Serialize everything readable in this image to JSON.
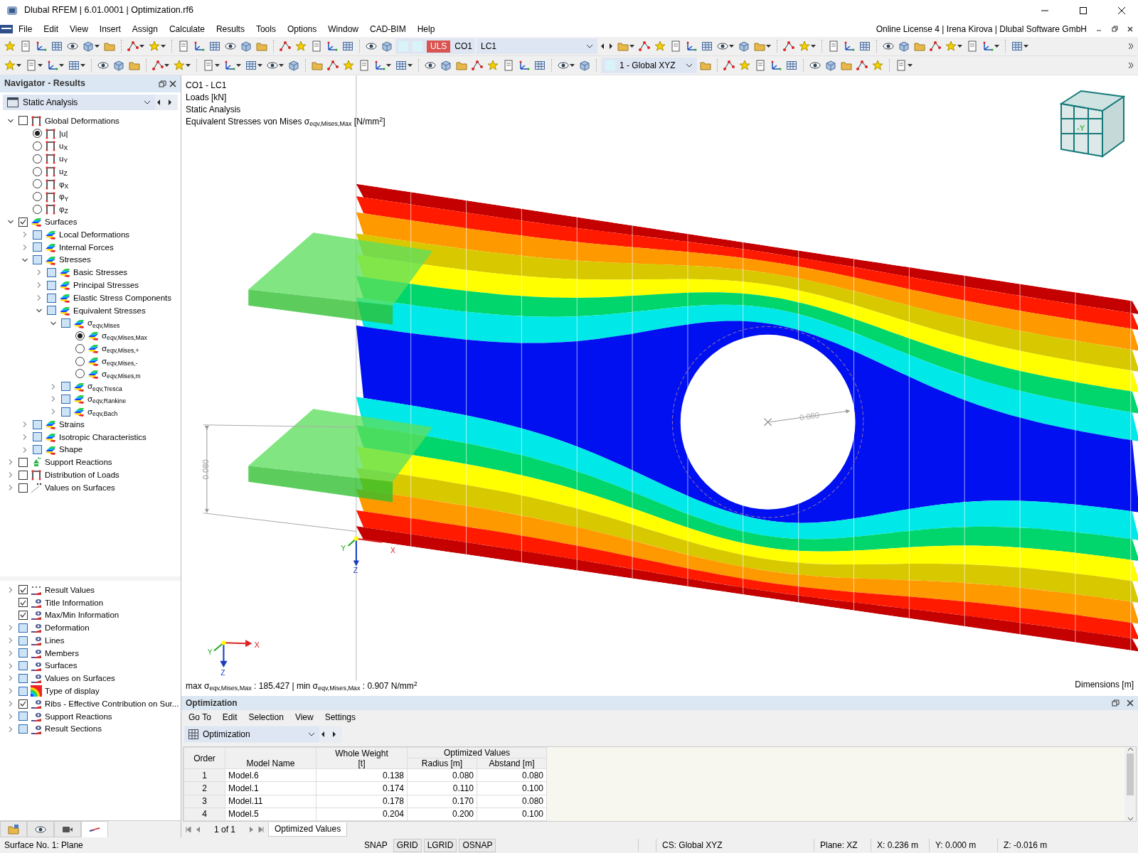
{
  "window": {
    "title": "Dlubal RFEM | 6.01.0001 | Optimization.rf6"
  },
  "menu": [
    "File",
    "Edit",
    "View",
    "Insert",
    "Assign",
    "Calculate",
    "Results",
    "Tools",
    "Options",
    "Window",
    "CAD-BIM",
    "Help"
  ],
  "license": "Online License 4 | Irena Kirova | Dlubal Software GmbH",
  "toolbar": {
    "design_situation": "ULS",
    "combination": "CO1",
    "load_case": "LC1",
    "coordinate_system": "1 - Global XYZ"
  },
  "navigator": {
    "title": "Navigator - Results",
    "analysis": "Static Analysis",
    "tree": [
      {
        "label": "Global Deformations",
        "kind": "deformation",
        "checked": false,
        "expanded": true,
        "children": [
          {
            "label": "|u|",
            "kind": "deformation",
            "selected": true
          },
          {
            "label": "u$_{X}$",
            "kind": "deformation",
            "selected": false
          },
          {
            "label": "u$_{Y}$",
            "kind": "deformation",
            "selected": false
          },
          {
            "label": "u$_{Z}$",
            "kind": "deformation",
            "selected": false
          },
          {
            "label": "φ$_{X}$",
            "kind": "deformation",
            "selected": false
          },
          {
            "label": "φ$_{Y}$",
            "kind": "deformation",
            "selected": false
          },
          {
            "label": "φ$_{Z}$",
            "kind": "deformation",
            "selected": false
          }
        ]
      },
      {
        "label": "Surfaces",
        "kind": "surface",
        "checked": true,
        "expanded": true,
        "children": [
          {
            "label": "Local Deformations",
            "kind": "surface",
            "checked": false,
            "expanded": false
          },
          {
            "label": "Internal Forces",
            "kind": "surface",
            "checked": false,
            "expanded": false
          },
          {
            "label": "Stresses",
            "kind": "surface",
            "checked": false,
            "expanded": true,
            "children": [
              {
                "label": "Basic Stresses",
                "kind": "surface",
                "checked": false,
                "expanded": false
              },
              {
                "label": "Principal Stresses",
                "kind": "surface",
                "checked": false,
                "expanded": false
              },
              {
                "label": "Elastic Stress Components",
                "kind": "surface",
                "checked": false,
                "expanded": false
              },
              {
                "label": "Equivalent Stresses",
                "kind": "surface",
                "checked": false,
                "expanded": true,
                "children": [
                  {
                    "label": "σ$_{eqv,Mises}$",
                    "kind": "surface",
                    "checked": false,
                    "expanded": true,
                    "children": [
                      {
                        "label": "σ$_{eqv,Mises,Max}$",
                        "kind": "surface",
                        "selected": true
                      },
                      {
                        "label": "σ$_{eqv,Mises,+}$",
                        "kind": "surface",
                        "selected": false
                      },
                      {
                        "label": "σ$_{eqv,Mises,-}$",
                        "kind": "surface",
                        "selected": false
                      },
                      {
                        "label": "σ$_{eqv,Mises,m}$",
                        "kind": "surface",
                        "selected": false
                      }
                    ]
                  },
                  {
                    "label": "σ$_{eqv,Tresca}$",
                    "kind": "surface",
                    "checked": false,
                    "expanded": false
                  },
                  {
                    "label": "σ$_{eqv,Rankine}$",
                    "kind": "surface",
                    "checked": false,
                    "expanded": false
                  },
                  {
                    "label": "σ$_{eqv,Bach}$",
                    "kind": "surface",
                    "checked": false,
                    "expanded": false
                  }
                ]
              }
            ]
          },
          {
            "label": "Strains",
            "kind": "surface",
            "checked": false,
            "expanded": false
          },
          {
            "label": "Isotropic Characteristics",
            "kind": "surface",
            "checked": false,
            "expanded": false
          },
          {
            "label": "Shape",
            "kind": "surface",
            "checked": false,
            "expanded": false
          }
        ]
      },
      {
        "label": "Support Reactions",
        "kind": "support",
        "checked": false,
        "expanded": false
      },
      {
        "label": "Distribution of Loads",
        "kind": "deformation",
        "checked": false,
        "expanded": false
      },
      {
        "label": "Values on Surfaces",
        "kind": "values",
        "checked": false,
        "expanded": false
      }
    ],
    "display": [
      {
        "label": "Result Values",
        "kind": "result-values",
        "checked": true,
        "expanded": false
      },
      {
        "label": "Title Information",
        "kind": "display",
        "checked": true
      },
      {
        "label": "Max/Min Information",
        "kind": "display",
        "checked": true
      },
      {
        "label": "Deformation",
        "kind": "display",
        "checked": false,
        "expanded": false
      },
      {
        "label": "Lines",
        "kind": "display",
        "checked": false,
        "expanded": false
      },
      {
        "label": "Members",
        "kind": "display",
        "checked": false,
        "expanded": false
      },
      {
        "label": "Surfaces",
        "kind": "display",
        "checked": false,
        "expanded": false
      },
      {
        "label": "Values on Surfaces",
        "kind": "display",
        "checked": false,
        "expanded": false
      },
      {
        "label": "Type of display",
        "kind": "display-type",
        "checked": false,
        "expanded": false
      },
      {
        "label": "Ribs - Effective Contribution on Sur...",
        "kind": "display",
        "checked": true,
        "expanded": false
      },
      {
        "label": "Support Reactions",
        "kind": "display",
        "checked": false,
        "expanded": false
      },
      {
        "label": "Result Sections",
        "kind": "display",
        "checked": false,
        "expanded": false
      }
    ],
    "tabs": [
      {
        "kind": "data",
        "selected": false
      },
      {
        "kind": "view",
        "selected": false
      },
      {
        "kind": "camera",
        "selected": false
      },
      {
        "kind": "results",
        "selected": true
      }
    ]
  },
  "viewport": {
    "title_lines": [
      "CO1 - LC1",
      "Loads [kN]",
      "Static Analysis",
      "Equivalent Stresses von Mises σ$_{eqv,Mises,Max}$ [N/mm$^{2}$]"
    ],
    "view_cube_label": "-Y",
    "dimension_labels": [
      "0.080",
      "0.080"
    ],
    "origin_axis_labels": [
      "Y",
      "X",
      "Z"
    ],
    "triad_axis_labels": [
      "Y",
      "X",
      "Z"
    ],
    "maxmin": "max σ$_{eqv,Mises,Max}$ : 185.427 | min σ$_{eqv,Mises,Max}$ : 0.907 N/mm$^{2}$",
    "dimensions": "Dimensions [m]"
  },
  "optimization": {
    "title": "Optimization",
    "menu": [
      "Go To",
      "Edit",
      "Selection",
      "View",
      "Settings"
    ],
    "selector": "Optimization",
    "table": {
      "group_header": "Optimized Values",
      "columns": [
        {
          "label": "Order"
        },
        {
          "label": "Model Name"
        },
        {
          "label": "Whole Weight",
          "unit": "[t]"
        },
        {
          "label": "Radius [m]"
        },
        {
          "label": "Abstand [m]"
        }
      ],
      "rows": [
        [
          "1",
          "Model.6",
          "0.138",
          "0.080",
          "0.080"
        ],
        [
          "2",
          "Model.1",
          "0.174",
          "0.110",
          "0.100"
        ],
        [
          "3",
          "Model.11",
          "0.178",
          "0.170",
          "0.080"
        ],
        [
          "4",
          "Model.5",
          "0.204",
          "0.200",
          "0.100"
        ]
      ]
    },
    "pager": "1 of 1",
    "tabs": [
      {
        "label": "Optimized Values",
        "selected": true
      }
    ]
  },
  "status_bar": {
    "info": "Surface No. 1: Plane",
    "toggles": [
      {
        "label": "SNAP",
        "on": false
      },
      {
        "label": "GRID",
        "on": true
      },
      {
        "label": "LGRID",
        "on": true
      },
      {
        "label": "OSNAP",
        "on": true
      }
    ],
    "fields": [
      "CS: Global XYZ",
      "Plane: XZ",
      "X: 0.236 m",
      "Y: 0.000 m",
      "Z: -0.016 m"
    ]
  }
}
